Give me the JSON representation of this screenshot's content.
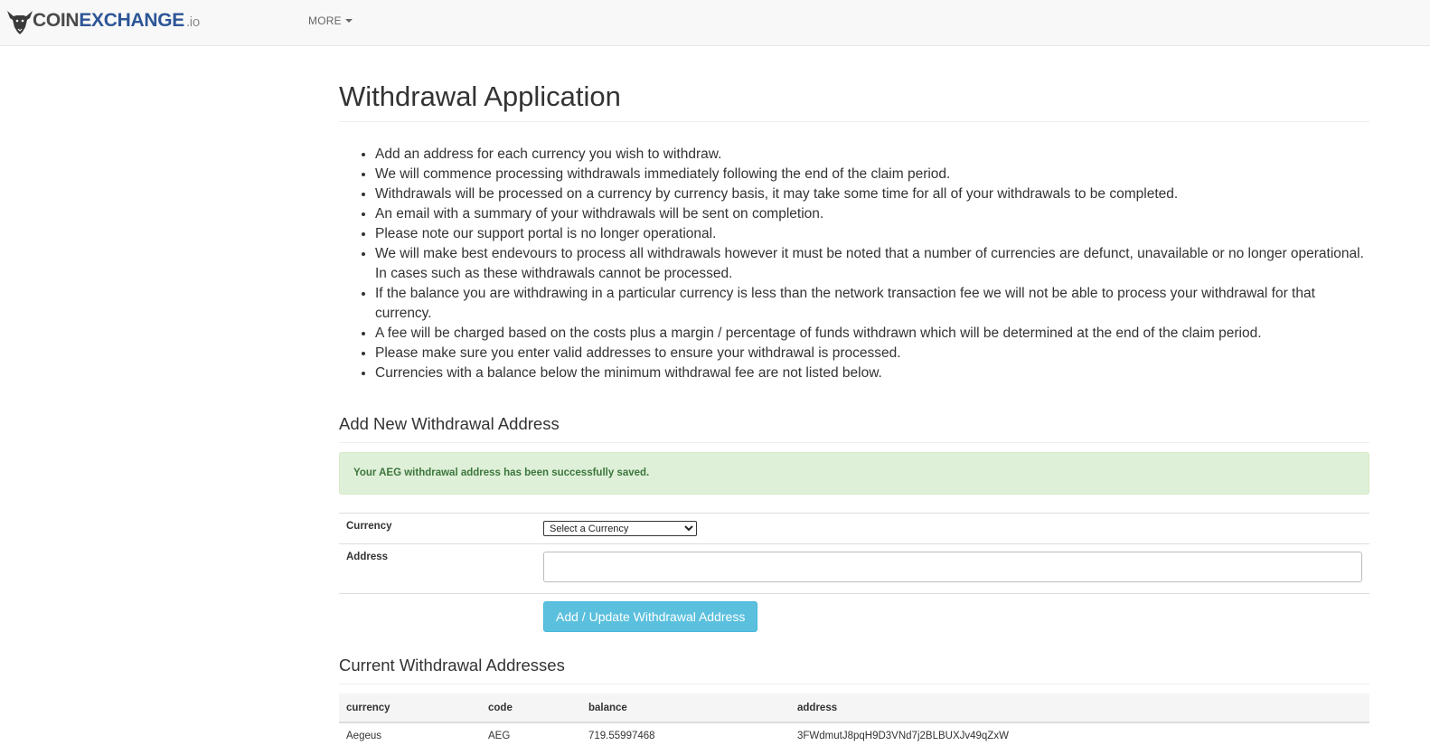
{
  "brand": {
    "part1": "COIN",
    "part2": "EXCHANGE",
    "part3": ".io",
    "icon": "bull-logo-icon"
  },
  "nav": {
    "more_label": "MORE"
  },
  "page": {
    "title": "Withdrawal Application"
  },
  "info_items": [
    "Add an address for each currency you wish to withdraw.",
    "We will commence processing withdrawals immediately following the end of the claim period.",
    "Withdrawals will be processed on a currency by currency basis, it may take some time for all of your withdrawals to be completed.",
    "An email with a summary of your withdrawals will be sent on completion.",
    "Please note our support portal is no longer operational.",
    "We will make best endevours to process all withdrawals however it must be noted that a number of currencies are defunct, unavailable or no longer operational. In cases such as these withdrawals cannot be processed.",
    "If the balance you are withdrawing in a particular currency is less than the network transaction fee we will not be able to process your withdrawal for that currency.",
    "A fee will be charged based on the costs plus a margin / percentage of funds withdrawn which will be determined at the end of the claim period.",
    "Please make sure you enter valid addresses to ensure your withdrawal is processed.",
    "Currencies with a balance below the minimum withdrawal fee are not listed below."
  ],
  "add_form": {
    "heading": "Add New Withdrawal Address",
    "alert_message": "Your AEG withdrawal address has been successfully saved.",
    "currency_label": "Currency",
    "currency_selected": "Select a Currency",
    "address_label": "Address",
    "address_value": "",
    "submit_label": "Add / Update Withdrawal Address"
  },
  "current": {
    "heading": "Current Withdrawal Addresses",
    "columns": [
      "currency",
      "code",
      "balance",
      "address"
    ],
    "rows": [
      {
        "currency": "Aegeus",
        "code": "AEG",
        "balance": "719.55997468",
        "address": "3FWdmutJ8pqH9D3VNd7j2BLBUXJv49qZxW"
      }
    ]
  },
  "colors": {
    "brand_dark": "#4a4a4a",
    "brand_blue": "#2d5697",
    "success_bg": "#dff0d8",
    "success_text": "#3c763d",
    "button_info": "#5bc0de"
  }
}
